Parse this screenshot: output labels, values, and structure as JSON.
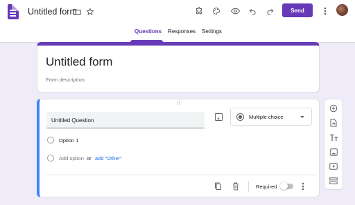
{
  "header": {
    "form_title": "Untitled form",
    "send_label": "Send",
    "icons": [
      "folder-icon",
      "star-icon",
      "addon-icon",
      "palette-icon",
      "preview-icon",
      "undo-icon",
      "redo-icon",
      "more-vert-icon"
    ]
  },
  "tabs": [
    {
      "label": "Questions",
      "active": true
    },
    {
      "label": "Responses",
      "active": false
    },
    {
      "label": "Settings",
      "active": false
    }
  ],
  "title_card": {
    "title": "Untitled form",
    "description_placeholder": "Form description"
  },
  "question": {
    "title": "Untitled Question",
    "type_label": "Multiple choice",
    "options": [
      "Option 1"
    ],
    "add_option": "Add option",
    "or_text": "or",
    "add_other": "add \"Other\"",
    "required_label": "Required",
    "required": false
  },
  "side_toolbar": [
    "add-question-icon",
    "import-questions-icon",
    "add-title-icon",
    "add-image-icon",
    "add-video-icon",
    "add-section-icon"
  ],
  "colors": {
    "accent": "#673ab7",
    "background": "#f0ebf8",
    "focus_border": "#4285f4",
    "link": "#1a73e8"
  }
}
